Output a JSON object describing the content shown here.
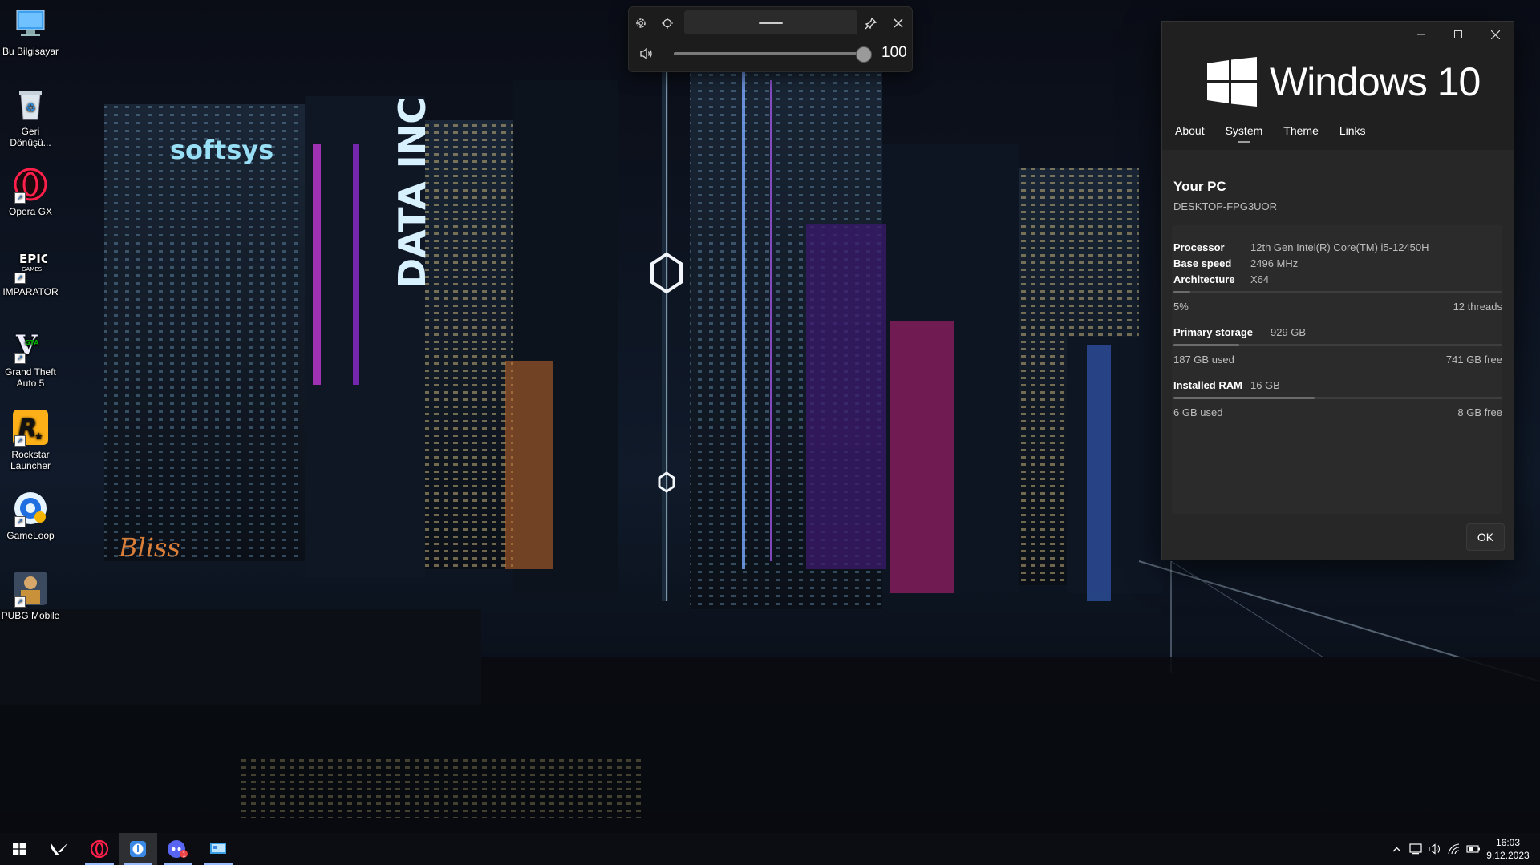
{
  "desktop": {
    "icons": [
      {
        "label": "Bu Bilgisayar",
        "icon": "computer-icon"
      },
      {
        "label": "Geri Dönüşü...",
        "icon": "recycle-bin-icon"
      },
      {
        "label": "Opera GX",
        "icon": "opera-gx-icon"
      },
      {
        "label": "IMPARATOR",
        "icon": "epic-games-icon"
      },
      {
        "label": "Grand Theft Auto 5",
        "icon": "gta5-icon"
      },
      {
        "label": "Rockstar Launcher",
        "icon": "rockstar-icon"
      },
      {
        "label": "GameLoop",
        "icon": "gameloop-icon"
      },
      {
        "label": "PUBG Mobile",
        "icon": "pubg-icon"
      }
    ],
    "wallpaper_signs": [
      "softsys",
      "DATA INC",
      "Bliss"
    ]
  },
  "volume_flyout": {
    "value_text": "100",
    "level_percent": 100,
    "icons": [
      "settings-icon",
      "move-icon",
      "pin-icon",
      "close-icon",
      "speaker-icon"
    ]
  },
  "about_window": {
    "logo_text": "Windows 10",
    "tabs": [
      "About",
      "System",
      "Theme",
      "Links"
    ],
    "active_tab": "System",
    "pc_title": "Your PC",
    "pc_name": "DESKTOP-FPG3UOR",
    "processor_label": "Processor",
    "processor_value": "12th Gen Intel(R) Core(TM) i5-12450H",
    "base_speed_label": "Base speed",
    "base_speed_value": "2496 MHz",
    "architecture_label": "Architecture",
    "architecture_value": "X64",
    "cpu_usage_text": "5%",
    "cpu_usage_percent": 5,
    "threads_text": "12 threads",
    "storage_label": "Primary storage",
    "storage_value": "929 GB",
    "storage_used": "187 GB used",
    "storage_free": "741 GB free",
    "storage_used_percent": 20,
    "ram_label": "Installed RAM",
    "ram_value": "16 GB",
    "ram_used": "6 GB used",
    "ram_free": "8 GB free",
    "ram_used_percent": 43,
    "ok_label": "OK",
    "colors": {
      "background": "#202020",
      "card": "#2b2b2b",
      "text_secondary": "#bdbdbd"
    }
  },
  "taskbar": {
    "apps": [
      "start-icon",
      "valorant-icon",
      "opera-gx-icon",
      "winver-icon",
      "discord-icon",
      "display-app-icon"
    ],
    "discord_badge": "1",
    "tray_icons": [
      "chevron-up-icon",
      "network-display-icon",
      "volume-icon",
      "wifi-icon",
      "battery-icon"
    ],
    "time": "16:03",
    "date": "9.12.2023"
  }
}
